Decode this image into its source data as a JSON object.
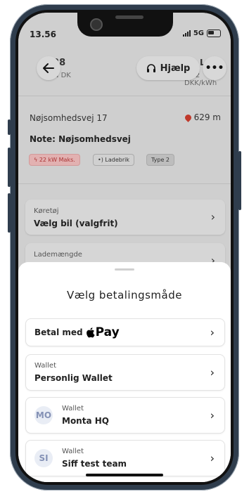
{
  "status": {
    "time": "13.56",
    "network": "5G"
  },
  "header": {
    "back_icon": "arrow-left-icon",
    "title_partial": "528",
    "subtitle_partial": "LSN DK",
    "right_title_partial": "Le",
    "right_sub_partial": "0,92 DKK/kWh",
    "help_label": "Hjælp",
    "more_icon": "ellipsis-icon"
  },
  "station": {
    "address": "Nøjsomhedsvej 17",
    "distance": "629 m",
    "note": "Note: Nøjsomhedsvej",
    "tags": [
      "22 kW Maks.",
      "Ladebrik",
      "Type 2"
    ]
  },
  "dim_cards": {
    "vehicle_small": "Køretøj",
    "vehicle_big": "Vælg bil (valgfrit)",
    "charge_small": "Lademængde"
  },
  "sheet": {
    "title": "Vælg betalingsmåde",
    "apple_pay_prefix": "Betal med",
    "apple_pay_word": "Pay",
    "options": [
      {
        "small": "Wallet",
        "big": "Personlig Wallet"
      },
      {
        "small": "Wallet",
        "big": "Monta HQ",
        "avatar": "MO"
      },
      {
        "small": "Wallet",
        "big": "Siff test team",
        "avatar": "SI"
      }
    ]
  },
  "colors": {
    "accent_red": "#c0392b",
    "avatar_text": "#8592b6",
    "avatar_bg": "#e9edf5"
  }
}
